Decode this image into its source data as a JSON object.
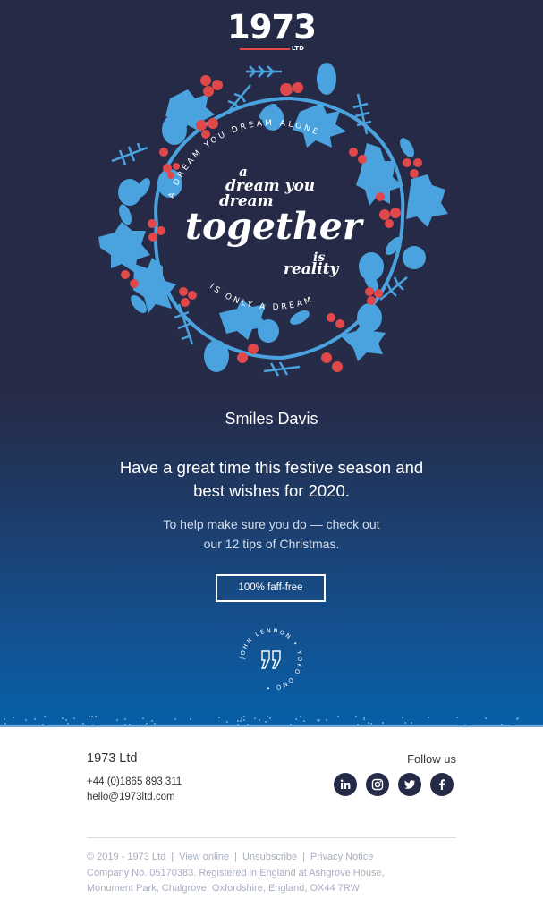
{
  "brand": {
    "logo_text": "1973",
    "logo_suffix": "LTD",
    "accent_red": "#e0484a",
    "leaf_blue": "#4aa3de",
    "navy": "#252a47"
  },
  "wreath": {
    "outer_ring_top": "A DREAM YOU DREAM ALONE",
    "outer_ring_bottom": "IS ONLY A DREAM",
    "line1": "a",
    "line2": "dream you",
    "line3": "dream",
    "line4": "together",
    "line5": "is",
    "line6": "reality"
  },
  "hero": {
    "recipient_name": "Smiles Davis",
    "headline_line1": "Have a great time this festive season and",
    "headline_line2": "best wishes for 2020.",
    "sub_line1": "To help make sure you do — check out",
    "sub_line2": "our 12 tips of Christmas.",
    "cta_label": "100% faff-free",
    "quote_badge_text": "JOHN LENNON • YOKO ONO •",
    "quote_icon": "quote-marks-icon"
  },
  "footer": {
    "company": "1973 Ltd",
    "phone": "+44 (0)1865 893 311",
    "email": "hello@1973ltd.com",
    "follow_label": "Follow us",
    "socials": [
      {
        "name": "linkedin",
        "icon": "linkedin-icon"
      },
      {
        "name": "instagram",
        "icon": "instagram-icon"
      },
      {
        "name": "twitter",
        "icon": "twitter-icon"
      },
      {
        "name": "facebook",
        "icon": "facebook-icon"
      }
    ],
    "copyright": "© 2019 - 1973 Ltd",
    "links": [
      "View online",
      "Unsubscribe",
      "Privacy Notice"
    ],
    "legal_line1": "Company No. 05170383. Registered in England at Ashgrove House,",
    "legal_line2": "Monument Park, Chalgrove, Oxfordshire, England, OX44 7RW"
  }
}
